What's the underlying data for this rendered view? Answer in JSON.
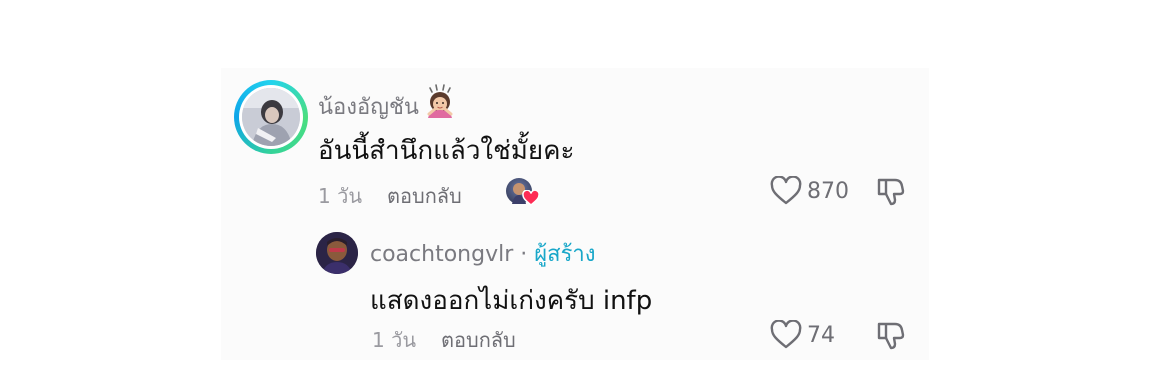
{
  "comment": {
    "author": "น้องอัญชัน",
    "author_emoji": "woman-gesturing-ok-emoji",
    "text": "อันนี้สำนึกแล้วใช่มั้ยคะ",
    "time": "1 วัน",
    "reply_label": "ตอบกลับ",
    "like_count": "870",
    "liked_by_creator": true
  },
  "reply": {
    "author": "coachtongvlr",
    "separator": "·",
    "creator_label": "ผู้สร้าง",
    "text": "แสดงออกไม่เก่งครับ infp",
    "time": "1 วัน",
    "reply_label": "ตอบกลับ",
    "like_count": "74"
  },
  "colors": {
    "creator_accent": "#18a7c9",
    "ring_start": "#22d3ee",
    "ring_end": "#4ade80",
    "heart": "#fe2c55"
  },
  "icons": [
    "heart-outline-icon",
    "thumbs-down-icon",
    "liked-by-creator-heart-icon"
  ]
}
